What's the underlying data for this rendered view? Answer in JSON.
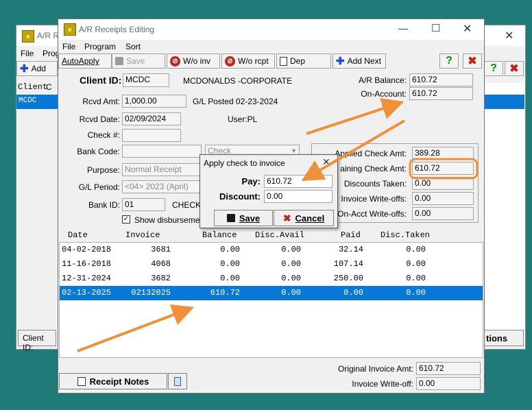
{
  "back_window": {
    "title": "A/R Re",
    "menu": [
      "File",
      "Prog"
    ],
    "add_label": "Add",
    "client_col": "Client",
    "row_value": "MCDC",
    "client_id_label": "Client ID:",
    "options_label": "tions"
  },
  "window": {
    "title": "A/R Receipts Editing",
    "minimize": "—",
    "maximize": "☐",
    "close": "✕"
  },
  "menu": [
    "File",
    "Program",
    "Sort"
  ],
  "toolbar": {
    "autoapply": "AutoApply",
    "save": "Save",
    "wo_inv": "W/o inv",
    "wo_rcpt": "W/o rcpt",
    "dep": "Dep",
    "add_next": "Add Next",
    "help": "?",
    "cancel": "✖"
  },
  "form": {
    "client_id_label": "Client ID:",
    "client_id": "MCDC",
    "client_name": "MCDONALDS -CORPORATE",
    "rcvd_amt_label": "Rcvd Amt:",
    "rcvd_amt": "1,000.00",
    "gl_posted": "G/L Posted 02-23-2024",
    "rcvd_date_label": "Rcvd Date:",
    "rcvd_date": "02/09/2024",
    "user": "User:PL",
    "check_label": "Check #:",
    "check_no": "",
    "bank_code_label": "Bank Code:",
    "bank_code": "",
    "check_type": "Check",
    "purpose_label": "Purpose:",
    "purpose": "Normal Receipt",
    "gl_period_label": "G/L Period:",
    "gl_period": "<04> 2023 (April)",
    "bank_id_label": "Bank ID:",
    "bank_id": "01",
    "checking": "CHECKI",
    "show_disb": "Show disbursemen",
    "show_disb_checked": true
  },
  "summary": {
    "ar_balance_label": "A/R Balance:",
    "ar_balance": "610.72",
    "on_account_label": "On-Account:",
    "on_account": "610.72",
    "applied_label": "Applied Check Amt:",
    "applied": "389.28",
    "remaining_label": "aining Check Amt:",
    "remaining": "610.72",
    "discounts_label": "Discounts Taken:",
    "discounts": "0.00",
    "inv_wo_label": "Invoice Write-offs:",
    "inv_wo": "0.00",
    "onacct_wo_label": "On-Acct Write-offs:",
    "onacct_wo": "0.00"
  },
  "table": {
    "headers": [
      "Date",
      "Invoice",
      "Balance",
      "Disc.Avail",
      "Paid",
      "Disc.Taken"
    ],
    "rows": [
      [
        "04-02-2018",
        "3681",
        "0.00",
        "0.00",
        "32.14",
        "0.00"
      ],
      [
        "11-16-2018",
        "4068",
        "0.00",
        "0.00",
        "107.14",
        "0.00"
      ],
      [
        "12-31-2024",
        "3682",
        "0.00",
        "0.00",
        "250.00",
        "0.00"
      ],
      [
        "02-13-2025",
        "02132025",
        "610.72",
        "0.00",
        "0.00",
        "0.00"
      ]
    ],
    "selected_row": 3
  },
  "footer": {
    "receipt_notes": "Receipt Notes",
    "orig_inv_label": "Original Invoice Amt:",
    "orig_inv": "610.72",
    "inv_wo_label": "Invoice Write-off:",
    "inv_wo": "0.00"
  },
  "dialog": {
    "title": "Apply check to invoice",
    "pay_label": "Pay:",
    "pay": "610.72",
    "discount_label": "Discount:",
    "discount": "0.00",
    "save": "Save",
    "cancel": "Cancel"
  },
  "colors": {
    "background": "#1e7b77",
    "selection": "#0878d7",
    "annotation": "#f0913a"
  }
}
